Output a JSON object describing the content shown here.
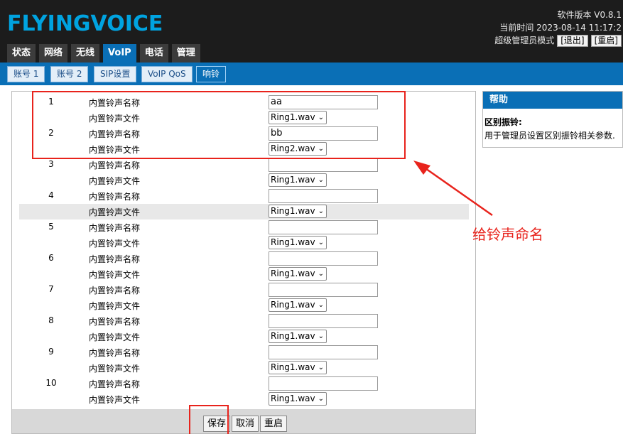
{
  "header": {
    "logo": "FLYINGVOICE",
    "version": "软件版本 V0.8.1",
    "time": "当前时间 2023-08-14 11:17:2",
    "mode": "超级管理员模式",
    "logout": "[退出]",
    "reboot": "[重启]"
  },
  "main_tabs": [
    "状态",
    "网络",
    "无线",
    "VoIP",
    "电话",
    "管理"
  ],
  "active_main_tab": "VoIP",
  "sub_tabs": [
    "账号 1",
    "账号 2",
    "SIP设置",
    "VoIP QoS",
    "响铃"
  ],
  "active_sub_tab": "响铃",
  "rings": [
    {
      "num": "1",
      "name_label": "内置铃声名称",
      "name": "aa",
      "file_label": "内置铃声文件",
      "file": "Ring1.wav"
    },
    {
      "num": "2",
      "name_label": "内置铃声名称",
      "name": "bb",
      "file_label": "内置铃声文件",
      "file": "Ring2.wav"
    },
    {
      "num": "3",
      "name_label": "内置铃声名称",
      "name": "",
      "file_label": "内置铃声文件",
      "file": "Ring1.wav"
    },
    {
      "num": "4",
      "name_label": "内置铃声名称",
      "name": "",
      "file_label": "内置铃声文件",
      "file": "Ring1.wav"
    },
    {
      "num": "5",
      "name_label": "内置铃声名称",
      "name": "",
      "file_label": "内置铃声文件",
      "file": "Ring1.wav"
    },
    {
      "num": "6",
      "name_label": "内置铃声名称",
      "name": "",
      "file_label": "内置铃声文件",
      "file": "Ring1.wav"
    },
    {
      "num": "7",
      "name_label": "内置铃声名称",
      "name": "",
      "file_label": "内置铃声文件",
      "file": "Ring1.wav"
    },
    {
      "num": "8",
      "name_label": "内置铃声名称",
      "name": "",
      "file_label": "内置铃声文件",
      "file": "Ring1.wav"
    },
    {
      "num": "9",
      "name_label": "内置铃声名称",
      "name": "",
      "file_label": "内置铃声文件",
      "file": "Ring1.wav"
    },
    {
      "num": "10",
      "name_label": "内置铃声名称",
      "name": "",
      "file_label": "内置铃声文件",
      "file": "Ring1.wav"
    }
  ],
  "buttons": {
    "save": "保存",
    "cancel": "取消",
    "reboot": "重启"
  },
  "help": {
    "header": "帮助",
    "title": "区别振铃:",
    "text": "用于管理员设置区别振铃相关参数."
  },
  "annotation": {
    "text": "给铃声命名"
  },
  "colors": {
    "brand": "#00a3e0",
    "accent": "#0a6fb6",
    "annotation": "#e8231c"
  }
}
